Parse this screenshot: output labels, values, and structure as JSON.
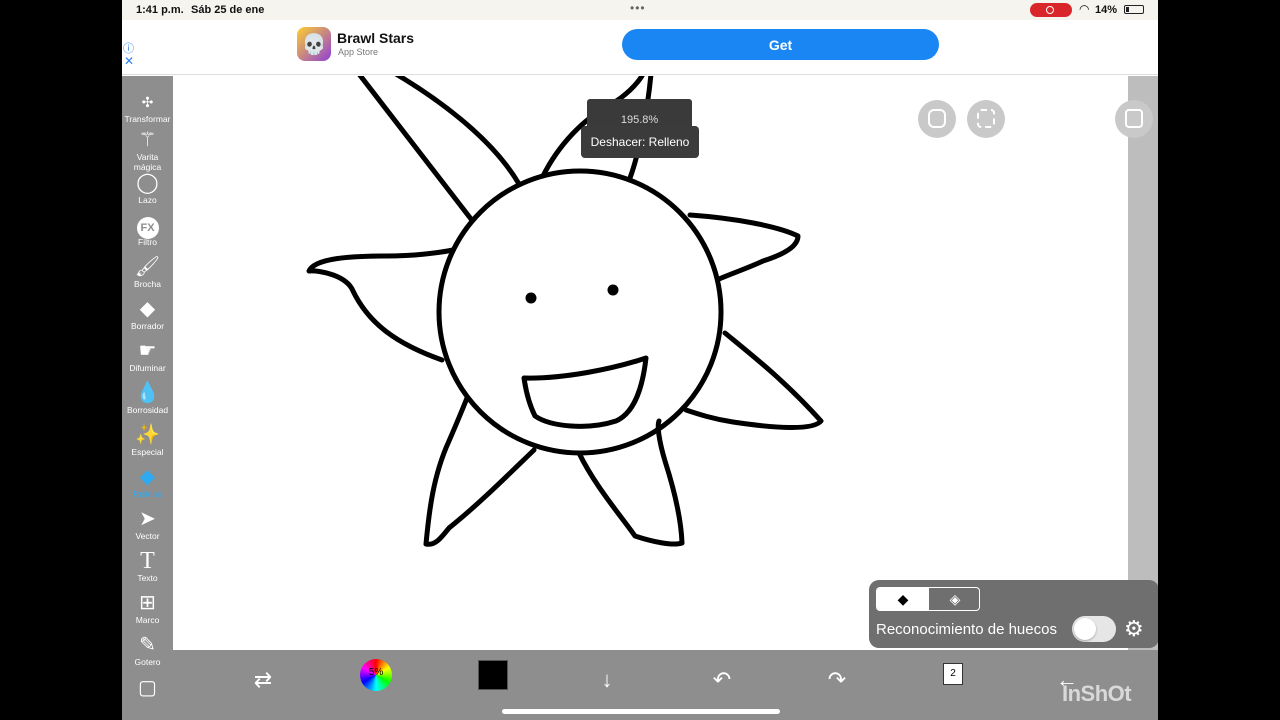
{
  "status_bar": {
    "time": "1:41 p.m.",
    "date": "Sáb 25 de ene",
    "battery": "14%"
  },
  "ad": {
    "app_name": "Brawl Stars",
    "app_source": "App Store",
    "get_label": "Get"
  },
  "toolbar": {
    "items": [
      {
        "label": "Transformar",
        "icon": "move-icon"
      },
      {
        "label": "Varita mágica",
        "icon": "magic-wand-icon"
      },
      {
        "label": "Lazo",
        "icon": "lasso-icon"
      },
      {
        "label": "Filtro",
        "icon": "fx-icon",
        "glyph": "FX"
      },
      {
        "label": "Brocha",
        "icon": "brush-icon"
      },
      {
        "label": "Borrador",
        "icon": "eraser-icon"
      },
      {
        "label": "Difuminar",
        "icon": "smudge-icon"
      },
      {
        "label": "Borrosidad",
        "icon": "blur-drop-icon"
      },
      {
        "label": "Especial",
        "icon": "special-icon"
      },
      {
        "label": "Relleno",
        "icon": "fill-bucket-icon"
      },
      {
        "label": "Vector",
        "icon": "cursor-arrow-icon"
      },
      {
        "label": "Texto",
        "icon": "text-icon",
        "glyph": "T"
      },
      {
        "label": "Marco",
        "icon": "frame-icon"
      },
      {
        "label": "Gotero",
        "icon": "eyedropper-icon"
      }
    ]
  },
  "canvas": {
    "zoom": "195.8%",
    "undo_message": "Deshacer: Relleno"
  },
  "fill_panel": {
    "gap_recognition_label": "Reconocimiento de huecos"
  },
  "bottom_bar": {
    "color_picker_label": "5%",
    "layers_count": "2"
  },
  "watermark": "InShOt",
  "colors": {
    "toolbar_bg": "#8e8e8e",
    "active_tool": "#2fa9f0",
    "get_button": "#1a86f4",
    "record_indicator": "#d9262b"
  }
}
